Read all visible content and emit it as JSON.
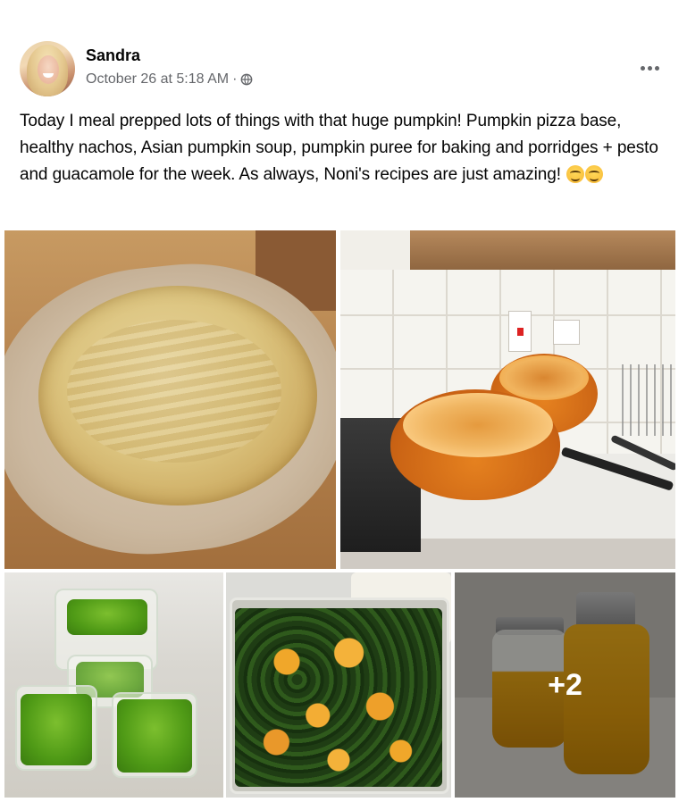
{
  "post": {
    "author": "Sandra",
    "timestamp": "October 26 at 5:18 AM",
    "separator": "·",
    "audience_icon": "globe-icon",
    "more_icon": "ellipsis-icon",
    "text": "Today I meal prepped lots of things with that huge pumpkin! Pumpkin pizza base, healthy nachos, Asian pumpkin soup, pumpkin puree for baking and porridges + pesto and guacamole for the week. As always, Noni's recipes are just amazing!",
    "emojis": [
      "smiling-face-emoji",
      "smiling-face-emoji"
    ]
  },
  "photos": {
    "items": [
      {
        "name": "pumpkin-pizza-base-photo"
      },
      {
        "name": "halved-pumpkin-photo"
      },
      {
        "name": "pesto-tubs-photo"
      },
      {
        "name": "roasted-pumpkin-kale-photo"
      },
      {
        "name": "pumpkin-puree-jars-photo"
      }
    ],
    "more_count": "+2"
  },
  "colors": {
    "text": "#050505",
    "secondary_text": "#65676b",
    "background": "#ffffff"
  }
}
